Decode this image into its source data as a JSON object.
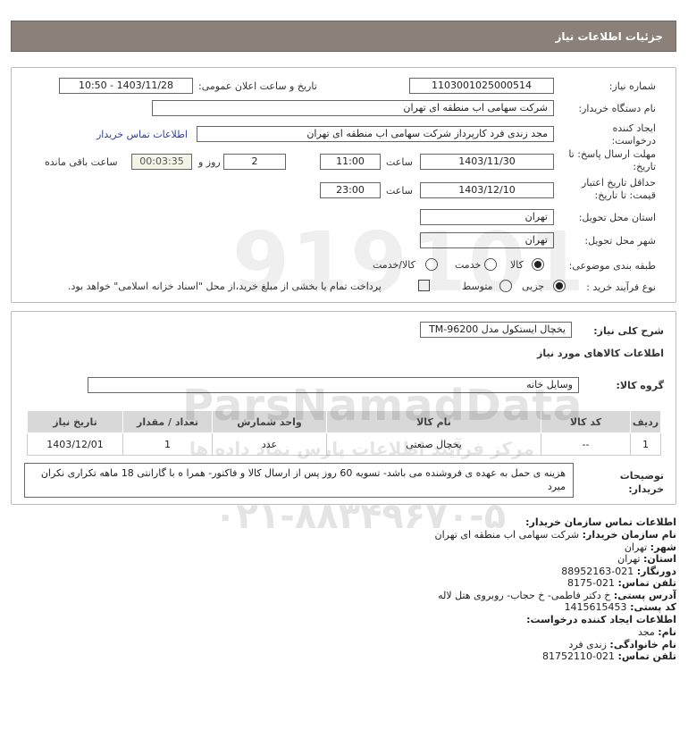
{
  "header": {
    "title": "جزئیات اطلاعات نیاز"
  },
  "form": {
    "need_number_label": "شماره نیاز:",
    "need_number": "1103001025000514",
    "announce_label": "تاریخ و ساعت اعلان عمومی:",
    "announce_value": "1403/11/28 - 10:50",
    "buyer_org_label": "نام دستگاه خریدار:",
    "buyer_org": "شرکت سهامی اب منطقه ای تهران",
    "creator_label": "ایجاد کننده درخواست:",
    "creator": "مجد زندی فرد کارپرداز شرکت سهامی اب منطقه ای تهران",
    "contact_link": "اطلاعات تماس خریدار",
    "reply_deadline_label": "مهلت ارسال پاسخ: تا تاریخ:",
    "reply_date": "1403/11/30",
    "time_label": "ساعت",
    "reply_time": "11:00",
    "days": "2",
    "days_label": "روز و",
    "remaining": "00:03:35",
    "remaining_label": "ساعت باقی مانده",
    "validity_label": "حداقل تاریخ اعتبار قیمت: تا تاریخ:",
    "validity_date": "1403/12/10",
    "validity_time": "23:00",
    "province_label": "استان محل تحویل:",
    "province": "تهران",
    "city_label": "شهر محل تحویل:",
    "city": "تهران",
    "category_label": "طبقه بندی موضوعی:",
    "category_options": [
      "کالا",
      "خدمت",
      "کالا/خدمت"
    ],
    "category_selected": "کالا",
    "process_label": "نوع فرآیند خرید :",
    "process_options": [
      "جزیی",
      "متوسط"
    ],
    "process_selected": "جزیی",
    "payment_note": "پرداخت تمام یا بخشی از مبلغ خرید،از محل \"اسناد خزانه اسلامی\" خواهد بود."
  },
  "details": {
    "summary_label": "شرح کلی نیاز:",
    "summary": "یخچال ایستکول مدل TM-96200",
    "goods_info_title": "اطلاعات کالاهای مورد نیاز",
    "group_label": "گروه کالا:",
    "group": "وسایل خانه",
    "table": {
      "headers": [
        "ردیف",
        "کد کالا",
        "نام کالا",
        "واحد شمارش",
        "تعداد / مقدار",
        "تاریخ نیاز"
      ],
      "rows": [
        [
          "1",
          "--",
          "یخچال صنعتی",
          "عدد",
          "1",
          "1403/12/01"
        ]
      ]
    },
    "notes_label": "توضیحات خریدار:",
    "notes": "هزینه ی حمل به عهده ی فروشنده می باشد- تسویه 60 روز پس از ارسال کالا و فاکتور- همرا ه با گارانتی 18 ماهه تکراری نکران میرد"
  },
  "contact": {
    "title": "اطلاعات تماس سازمان خریدار:",
    "org_label": "نام سازمان خریدار:",
    "org": "شرکت سهامی اب منطقه ای تهران",
    "city_label": "شهر:",
    "city": "تهران",
    "province_label": "استان:",
    "province": "تهران",
    "fax_label": "دورنگار:",
    "fax": "021-88952163",
    "phone_label": "تلفن تماس:",
    "phone": "021-8175",
    "address_label": "آدرس پستی:",
    "address": "خ دکتر فاطمی- خ حجاب- روبروی هتل لاله",
    "postal_label": "کد پستی:",
    "postal": "1415615453",
    "creator_title": "اطلاعات ایجاد کننده درخواست:",
    "name_label": "نام:",
    "name": "مجد",
    "family_label": "نام خانوادگی:",
    "family": "زندی فرد",
    "cphone_label": "تلفن تماس:",
    "cphone": "021-81752110"
  },
  "watermark": {
    "brand": "ParsNamadData",
    "tagline": "مرکز فرآیند اطلاعات پارس نماد داده ها",
    "phone": "۰۲۱-۸۸۳۴۹۶۷۰-۵"
  }
}
